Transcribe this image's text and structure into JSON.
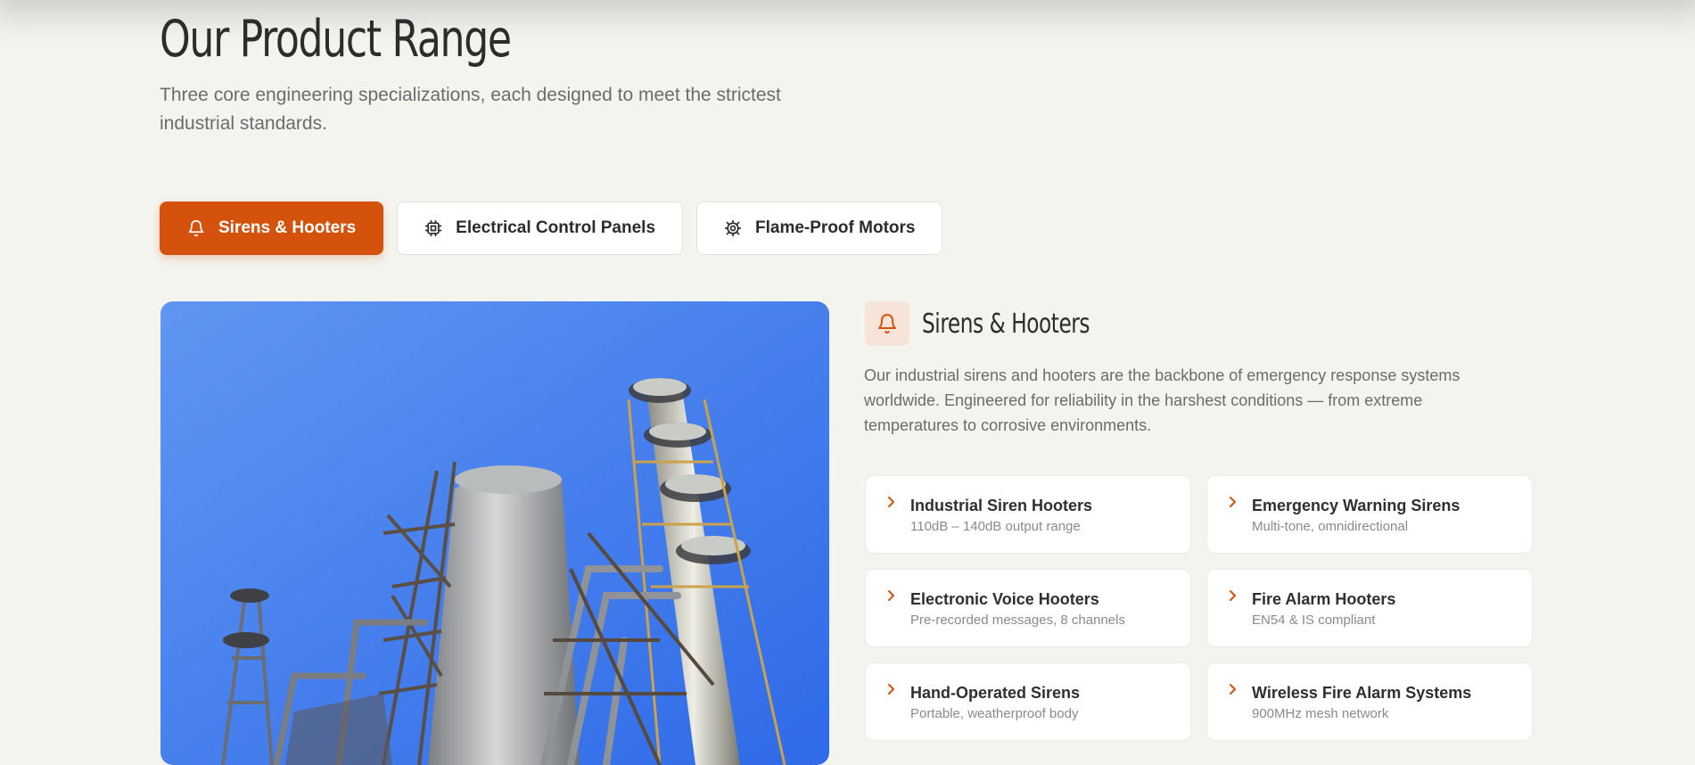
{
  "section": {
    "title": "Our Product Range",
    "subtitle": "Three core engineering specializations, each designed to meet the strictest industrial standards."
  },
  "tabs": [
    {
      "label": "Sirens & Hooters",
      "icon": "bell-icon",
      "active": true
    },
    {
      "label": "Electrical Control Panels",
      "icon": "chip-icon",
      "active": false
    },
    {
      "label": "Flame-Proof Motors",
      "icon": "gear-icon",
      "active": false
    }
  ],
  "detail": {
    "icon": "bell-icon",
    "title": "Sirens & Hooters",
    "description": "Our industrial sirens and hooters are the backbone of emergency response systems worldwide. Engineered for reliability in the harshest conditions — from extreme temperatures to corrosive environments.",
    "products": [
      {
        "name": "Industrial Siren Hooters",
        "meta": "110dB – 140dB output range"
      },
      {
        "name": "Emergency Warning Sirens",
        "meta": "Multi-tone, omnidirectional"
      },
      {
        "name": "Electronic Voice Hooters",
        "meta": "Pre-recorded messages, 8 channels"
      },
      {
        "name": "Fire Alarm Hooters",
        "meta": "EN54 & IS compliant"
      },
      {
        "name": "Hand-Operated Sirens",
        "meta": "Portable, weatherproof body"
      },
      {
        "name": "Wireless Fire Alarm Systems",
        "meta": "900MHz mesh network"
      }
    ]
  },
  "colors": {
    "accent": "#d4520b",
    "background": "#f4f4ef",
    "icon_tint": "#f6e4d8"
  }
}
